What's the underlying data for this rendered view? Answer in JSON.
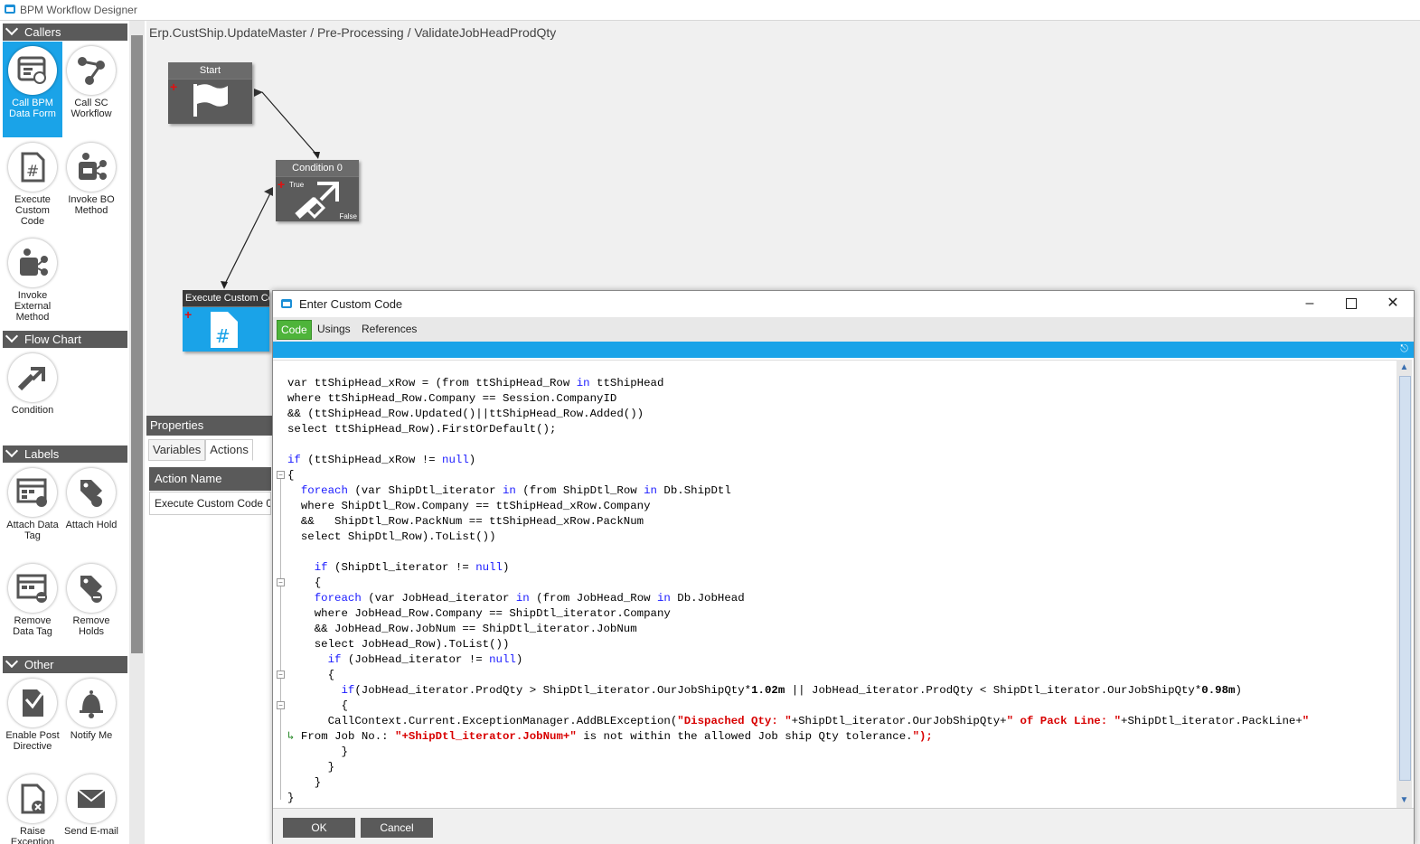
{
  "window": {
    "title": "BPM Workflow Designer"
  },
  "toolbox": {
    "sections": {
      "callers": "Callers",
      "flowchart": "Flow Chart",
      "labels": "Labels",
      "other": "Other"
    },
    "tools": {
      "call_bpm": "Call BPM Data Form",
      "call_sc": "Call SC Workflow",
      "exec_custom": "Execute Custom Code",
      "invoke_bo": "Invoke BO Method",
      "invoke_ext": "Invoke External Method",
      "condition": "Condition",
      "attach_tag": "Attach Data Tag",
      "attach_hold": "Attach Hold",
      "remove_tag": "Remove Data Tag",
      "remove_holds": "Remove Holds",
      "enable_post": "Enable Post Directive",
      "notify": "Notify Me",
      "raise": "Raise Exception",
      "send_email": "Send E-mail"
    }
  },
  "canvas": {
    "breadcrumb": "Erp.CustShip.UpdateMaster / Pre-Processing / ValidateJobHeadProdQty",
    "nodes": {
      "start": "Start",
      "condition": "Condition 0",
      "cond_true": "True",
      "cond_false": "False",
      "exec": "Execute Custom Co"
    }
  },
  "properties": {
    "title": "Properties",
    "tabs": [
      "Variables",
      "Actions"
    ],
    "column": "Action Name",
    "row": "Execute Custom Code 0"
  },
  "dialog": {
    "title": "Enter Custom Code",
    "tabs": [
      "Code",
      "Usings",
      "References"
    ],
    "ok": "OK",
    "cancel": "Cancel",
    "code_lines": [
      "var ttShipHead_xRow = (from ttShipHead_Row in ttShipHead",
      "where ttShipHead_Row.Company == Session.CompanyID",
      "&& (ttShipHead_Row.Updated()||ttShipHead_Row.Added())",
      "select ttShipHead_Row).FirstOrDefault();",
      "",
      "if (ttShipHead_xRow != null)",
      "{",
      "  foreach (var ShipDtl_iterator in (from ShipDtl_Row in Db.ShipDtl",
      "  where ShipDtl_Row.Company == ttShipHead_xRow.Company",
      "  &&   ShipDtl_Row.PackNum == ttShipHead_xRow.PackNum",
      "  select ShipDtl_Row).ToList())",
      "",
      "    if (ShipDtl_iterator != null)",
      "    {",
      "    foreach (var JobHead_iterator in (from JobHead_Row in Db.JobHead",
      "    where JobHead_Row.Company == ShipDtl_iterator.Company",
      "    && JobHead_Row.JobNum == ShipDtl_iterator.JobNum",
      "    select JobHead_Row).ToList())",
      "      if (JobHead_iterator != null)",
      "      {",
      "        if(JobHead_iterator.ProdQty > ShipDtl_iterator.OurJobShipQty*1.02m || JobHead_iterator.ProdQty < ShipDtl_iterator.OurJobShipQty*0.98m)",
      "        {",
      "      CallContext.Current.ExceptionManager.AddBLException(\"Dispached Qty: \"+ShipDtl_iterator.OurJobShipQty+\" of Pack Line: \"+ShipDtl_iterator.PackLine+\"",
      "From Job No.: \"+ShipDtl_iterator.JobNum+\" is not within the allowed Job ship Qty tolerance.\");",
      "        }",
      "      }",
      "    }",
      "}"
    ]
  }
}
